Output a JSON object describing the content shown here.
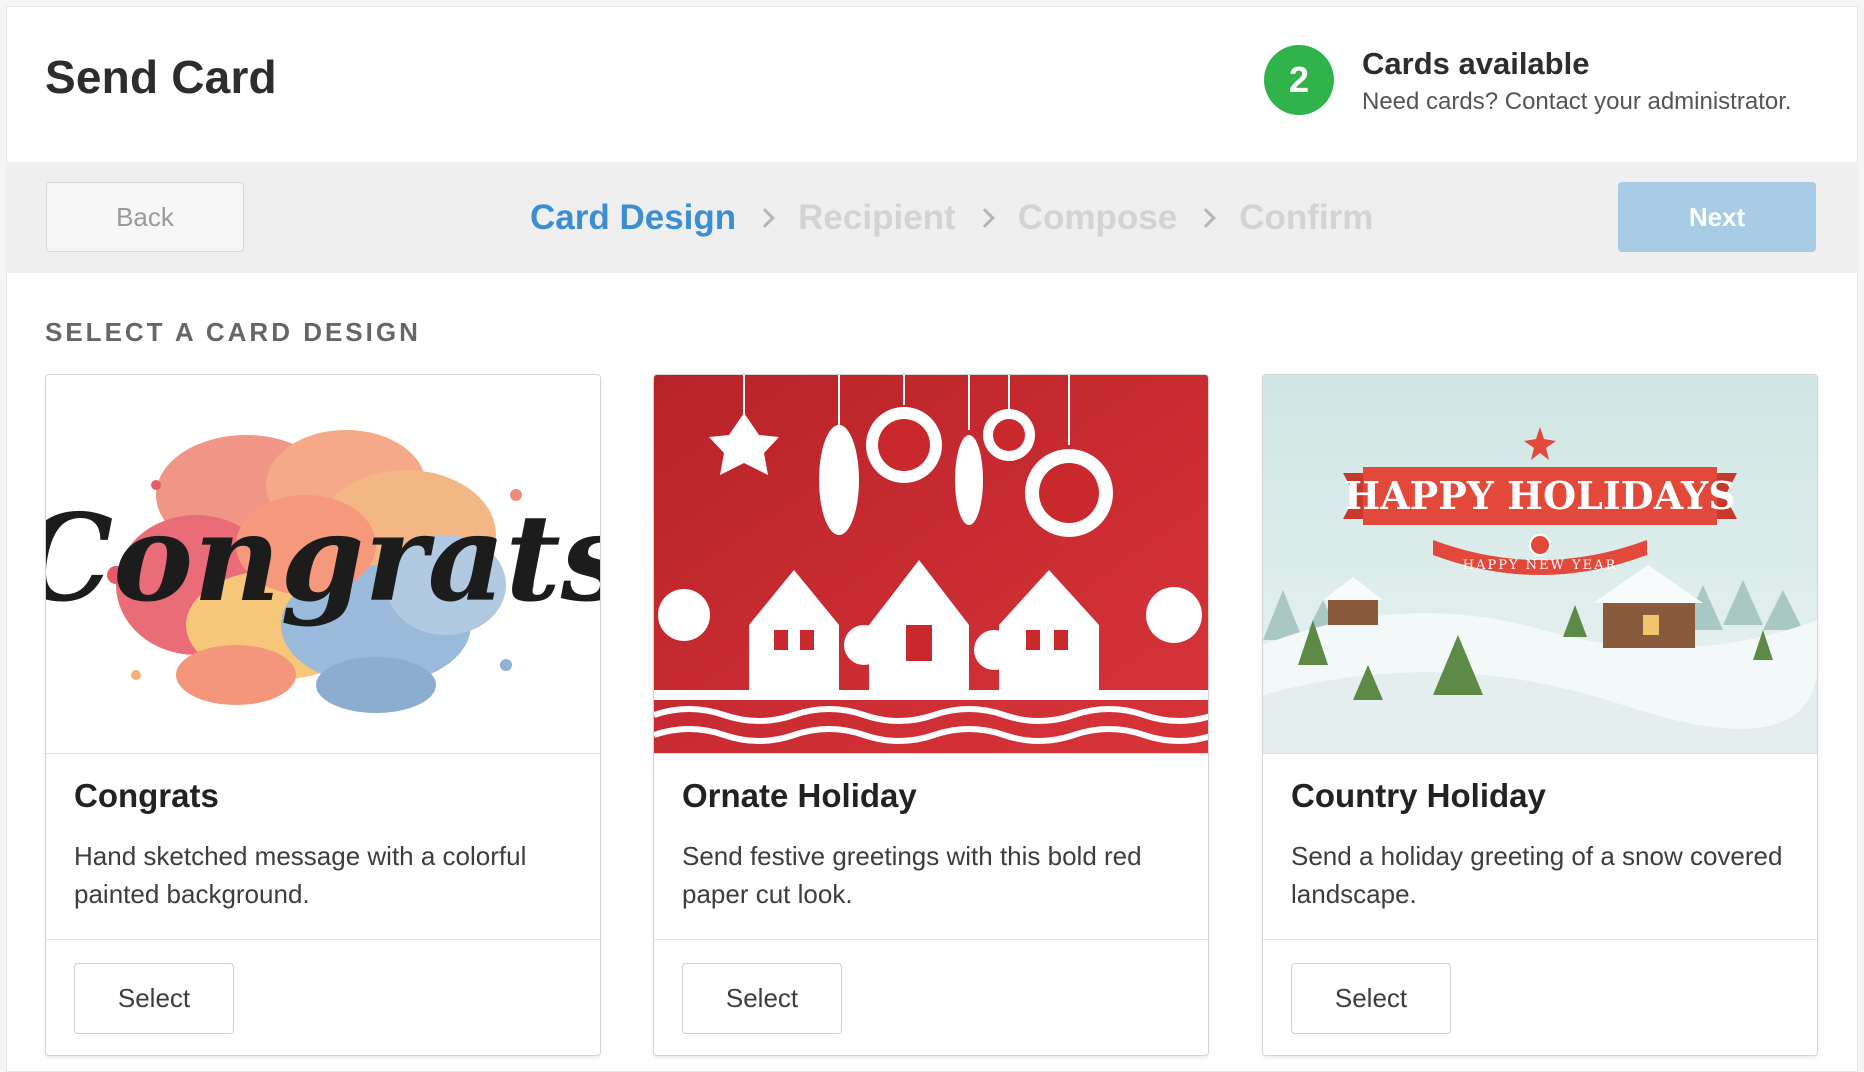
{
  "header": {
    "title": "Send Card",
    "cards_available_count": "2",
    "cards_available_label": "Cards available",
    "cards_available_help": "Need cards? Contact your administrator."
  },
  "toolbar": {
    "back_label": "Back",
    "next_label": "Next",
    "steps": [
      {
        "label": "Card Design",
        "active": true
      },
      {
        "label": "Recipient",
        "active": false
      },
      {
        "label": "Compose",
        "active": false
      },
      {
        "label": "Confirm",
        "active": false
      }
    ]
  },
  "section": {
    "label": "SELECT A CARD DESIGN"
  },
  "cards": [
    {
      "title": "Congrats",
      "description": "Hand sketched message with a colorful painted background.",
      "select_label": "Select",
      "image_text": "Congrats"
    },
    {
      "title": "Ornate Holiday",
      "description": "Send festive greetings with this bold red paper cut look.",
      "select_label": "Select"
    },
    {
      "title": "Country Holiday",
      "description": "Send a holiday greeting of a snow covered landscape.",
      "select_label": "Select",
      "image_text": "HAPPY HOLIDAYS",
      "image_subtext": "HAPPY NEW YEAR"
    }
  ],
  "colors": {
    "accent_blue": "#3a8fd4",
    "next_button": "#a8cbe6",
    "badge_green": "#2fb34a",
    "ornate_red": "#c9282d",
    "snow_sky": "#cfe6e6"
  }
}
